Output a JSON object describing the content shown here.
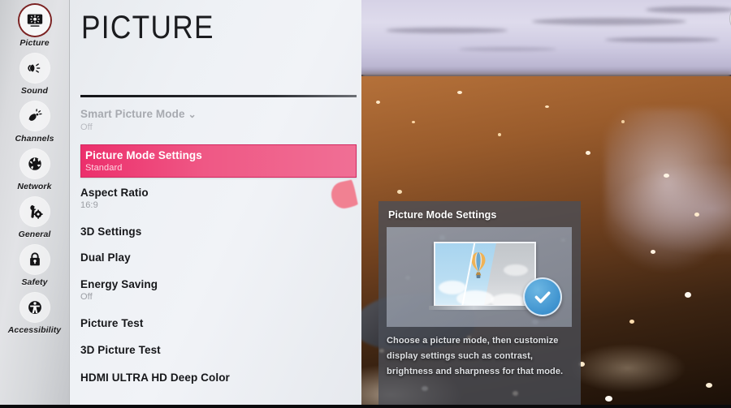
{
  "sidebar": {
    "items": [
      {
        "label": "Picture",
        "icon": "picture-icon",
        "active": true
      },
      {
        "label": "Sound",
        "icon": "sound-icon",
        "active": false
      },
      {
        "label": "Channels",
        "icon": "channels-icon",
        "active": false
      },
      {
        "label": "Network",
        "icon": "network-icon",
        "active": false
      },
      {
        "label": "General",
        "icon": "general-icon",
        "active": false
      },
      {
        "label": "Safety",
        "icon": "lock-icon",
        "active": false
      },
      {
        "label": "Accessibility",
        "icon": "accessibility-icon",
        "active": false
      }
    ]
  },
  "menu": {
    "title": "PICTURE",
    "items": [
      {
        "label": "Smart Picture Mode",
        "value": "Off",
        "state": "disabled",
        "chevron": "⌄"
      },
      {
        "label": "Picture Mode Settings",
        "value": "Standard",
        "state": "selected"
      },
      {
        "label": "Aspect Ratio",
        "value": "16:9",
        "state": "normal"
      },
      {
        "label": "3D Settings",
        "value": "",
        "state": "normal"
      },
      {
        "label": "Dual Play",
        "value": "",
        "state": "normal"
      },
      {
        "label": "Energy Saving",
        "value": "Off",
        "state": "normal"
      },
      {
        "label": "Picture Test",
        "value": "",
        "state": "normal"
      },
      {
        "label": "3D Picture Test",
        "value": "",
        "state": "normal"
      },
      {
        "label": "HDMI ULTRA HD Deep Color",
        "value": "",
        "state": "normal"
      }
    ]
  },
  "video": {
    "back_button_icon": "back-arrow-icon",
    "scene": "pebble-beach-photo"
  },
  "popup": {
    "title": "Picture Mode Settings",
    "description": "Choose a picture mode, then customize display settings such as contrast, brightness and sharpness for that mode.",
    "preview_icon": "tv-balloon-preview-icon",
    "badge_icon": "check-circle-icon"
  },
  "cursor": {
    "shape": "pink-teardrop-pointer"
  },
  "colors": {
    "highlight_pink": "#ec2f6c",
    "active_ring": "#7b2222",
    "panel_bg": "#eef1f5",
    "popup_bg": "#4a4e57",
    "check_blue": "#3f93cf",
    "cursor_pink": "#f2788a"
  }
}
